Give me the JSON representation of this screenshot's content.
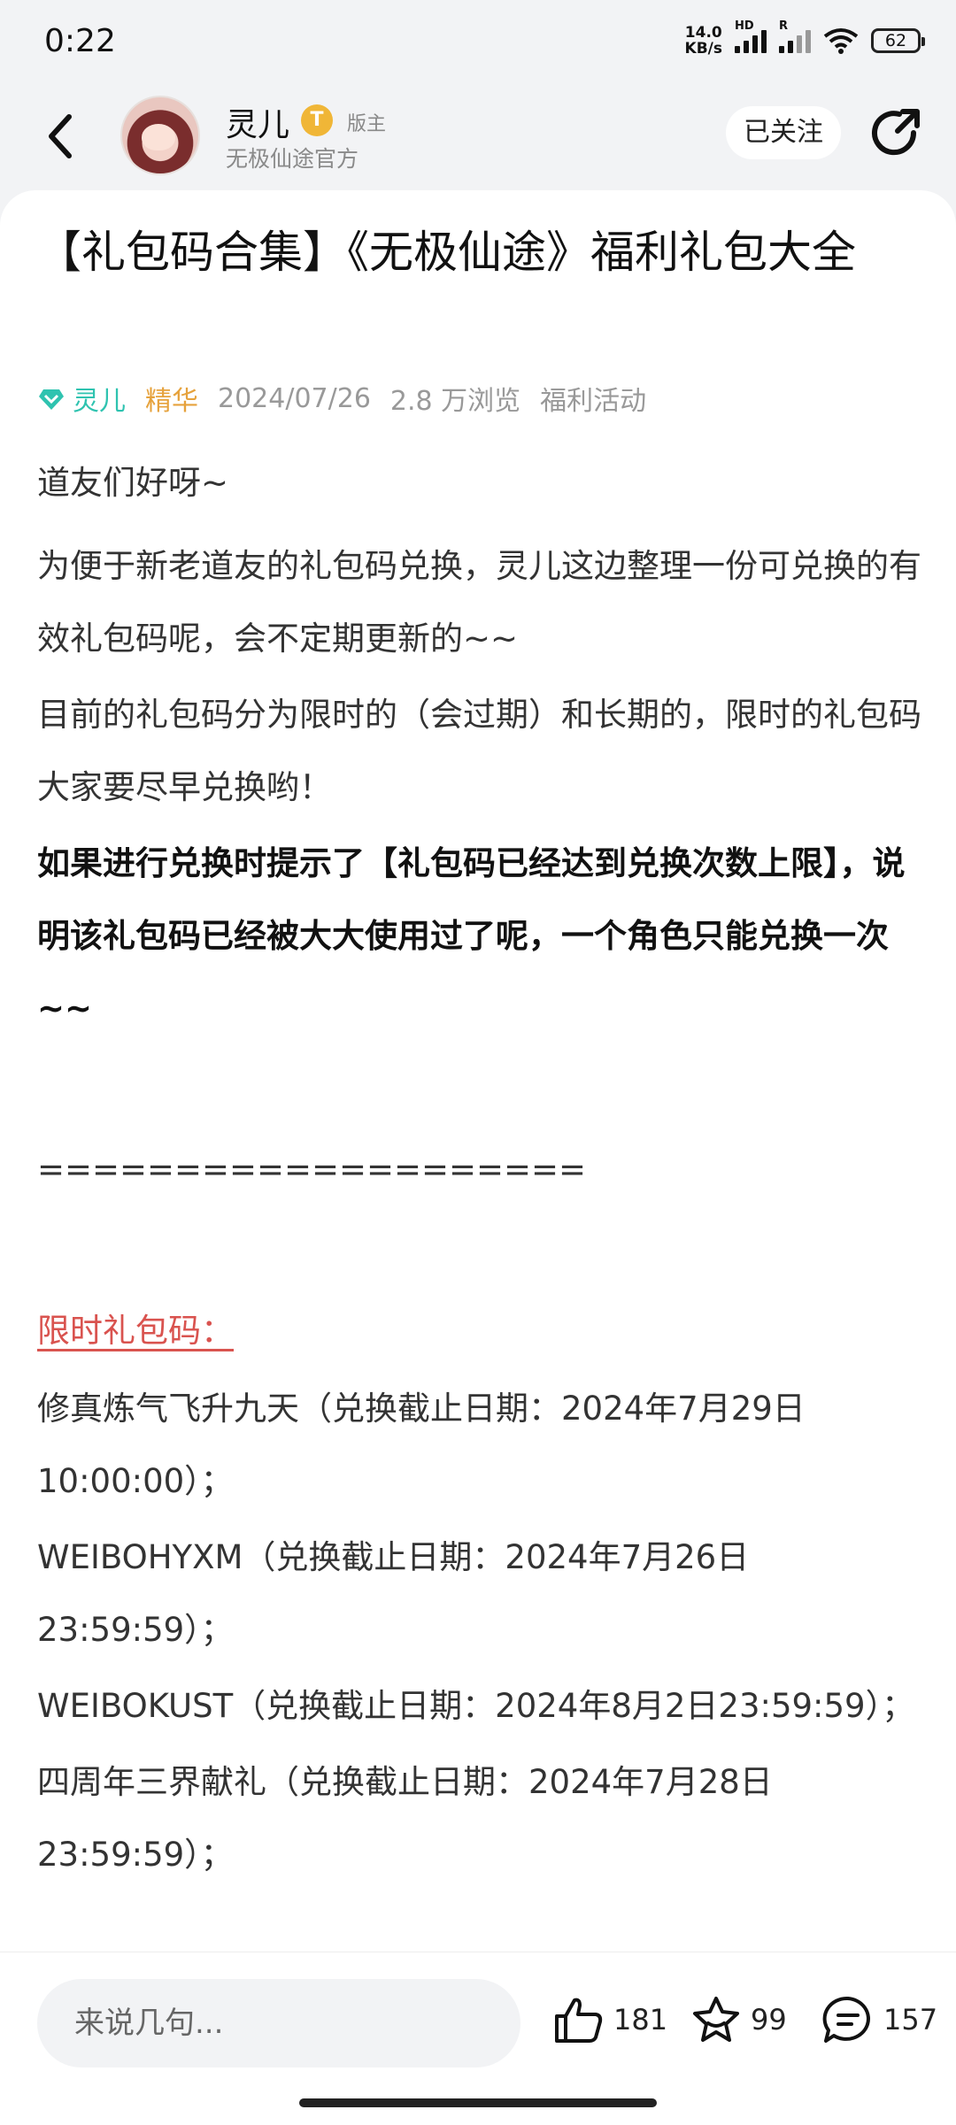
{
  "status_bar": {
    "time": "0:22",
    "net_speed_value": "14.0",
    "net_speed_unit": "KB/s",
    "signal1_tag": "HD",
    "signal2_tag": "R",
    "battery": "62"
  },
  "header": {
    "username": "灵儿",
    "badge_letter": "T",
    "role": "版主",
    "subtitle": "无极仙途官方",
    "follow_label": "已关注"
  },
  "post": {
    "title": "【礼包码合集】《无极仙途》福利礼包大全",
    "meta": {
      "author": "灵儿",
      "tag": "精华",
      "date": "2024/07/26",
      "views": "2.8 万浏览",
      "category": "福利活动"
    },
    "paragraphs": {
      "p1": "道友们好呀~",
      "p2": "为便于新老道友的礼包码兑换，灵儿这边整理一份可兑换的有效礼包码呢，会不定期更新的~~",
      "p3": "目前的礼包码分为限时的（会过期）和长期的，限时的礼包码大家要尽早兑换哟！",
      "p4": "如果进行兑换时提示了【礼包码已经达到兑换次数上限】，说明该礼包码已经被大大使用过了呢，一个角色只能兑换一次~~",
      "divider": "====================",
      "limited_heading": "限时礼包码：",
      "code1": "修真炼气飞升九天（兑换截止日期：2024年7月29日10:00:00）；",
      "code2": "WEIBOHYXM（兑换截止日期：2024年7月26日23:59:59）；",
      "code3": "WEIBOKUST（兑换截止日期：2024年8月2日23:59:59）；",
      "code4": "四周年三界献礼（兑换截止日期：2024年7月28日23:59:59）；"
    }
  },
  "bottom_bar": {
    "comment_placeholder": "来说几句...",
    "likes": "181",
    "favorites": "99",
    "comments": "157"
  },
  "colors": {
    "accent_teal": "#2fc3b0",
    "highlight_gold": "#e6a23c",
    "limited_red": "#d9534f"
  }
}
